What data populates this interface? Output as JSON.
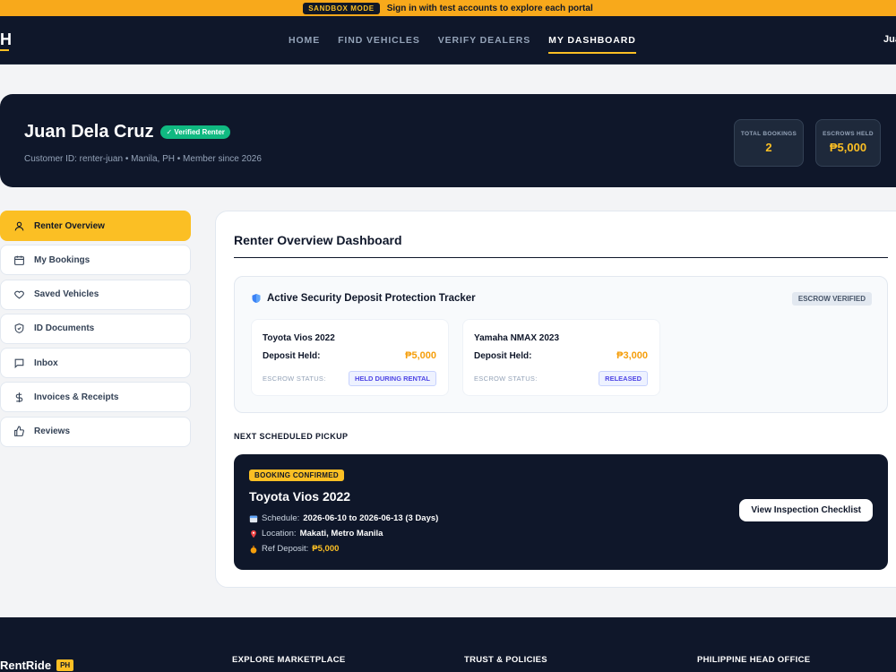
{
  "sandbox": {
    "badge": "SANDBOX MODE",
    "message": "Sign in with test accounts to explore each portal"
  },
  "nav": {
    "logo": "H",
    "links": [
      {
        "label": "HOME"
      },
      {
        "label": "FIND VEHICLES"
      },
      {
        "label": "VERIFY DEALERS"
      },
      {
        "label": "MY DASHBOARD",
        "active": true
      }
    ],
    "user": "Juan"
  },
  "profile": {
    "name": "Juan Dela Cruz",
    "badge": "✓ Verified Renter",
    "subtitle": "Customer ID: renter-juan • Manila, PH • Member since 2026",
    "stats": [
      {
        "label": "TOTAL BOOKINGS",
        "value": "2"
      },
      {
        "label": "ESCROWS HELD",
        "value": "₱5,000"
      }
    ]
  },
  "sidebar": {
    "items": [
      {
        "label": "Renter Overview",
        "icon": "user-icon",
        "active": true
      },
      {
        "label": "My Bookings",
        "icon": "calendar-icon"
      },
      {
        "label": "Saved Vehicles",
        "icon": "heart-icon"
      },
      {
        "label": "ID Documents",
        "icon": "shield-check-icon"
      },
      {
        "label": "Inbox",
        "icon": "message-icon"
      },
      {
        "label": "Invoices & Receipts",
        "icon": "dollar-icon"
      },
      {
        "label": "Reviews",
        "icon": "thumbs-up-icon"
      }
    ]
  },
  "overview": {
    "title": "Renter Overview Dashboard",
    "tracker": {
      "title": "Active Security Deposit Protection Tracker",
      "badge": "ESCROW VERIFIED",
      "deposits": [
        {
          "vehicle": "Toyota Vios 2022",
          "held_label": "Deposit Held:",
          "amount": "₱5,000",
          "status_label": "ESCROW STATUS:",
          "status": "HELD DURING RENTAL"
        },
        {
          "vehicle": "Yamaha NMAX 2023",
          "held_label": "Deposit Held:",
          "amount": "₱3,000",
          "status_label": "ESCROW STATUS:",
          "status": "RELEASED"
        }
      ]
    },
    "pickup": {
      "section_label": "NEXT SCHEDULED PICKUP",
      "badge": "BOOKING CONFIRMED",
      "vehicle": "Toyota Vios 2022",
      "schedule_label": "Schedule:",
      "schedule": "2026-06-10 to 2026-06-13 (3 Days)",
      "location_label": "Location:",
      "location": "Makati, Metro Manila",
      "deposit_label": "Ref Deposit:",
      "deposit": "₱5,000",
      "button": "View Inspection Checklist"
    }
  },
  "footer": {
    "brand": "RentRide",
    "brand_tag": "PH",
    "columns": [
      "EXPLORE MARKETPLACE",
      "TRUST & POLICIES",
      "PHILIPPINE HEAD OFFICE"
    ]
  },
  "colors": {
    "navy": "#0f172a",
    "accent": "#fbbf24",
    "success": "#10b981"
  }
}
